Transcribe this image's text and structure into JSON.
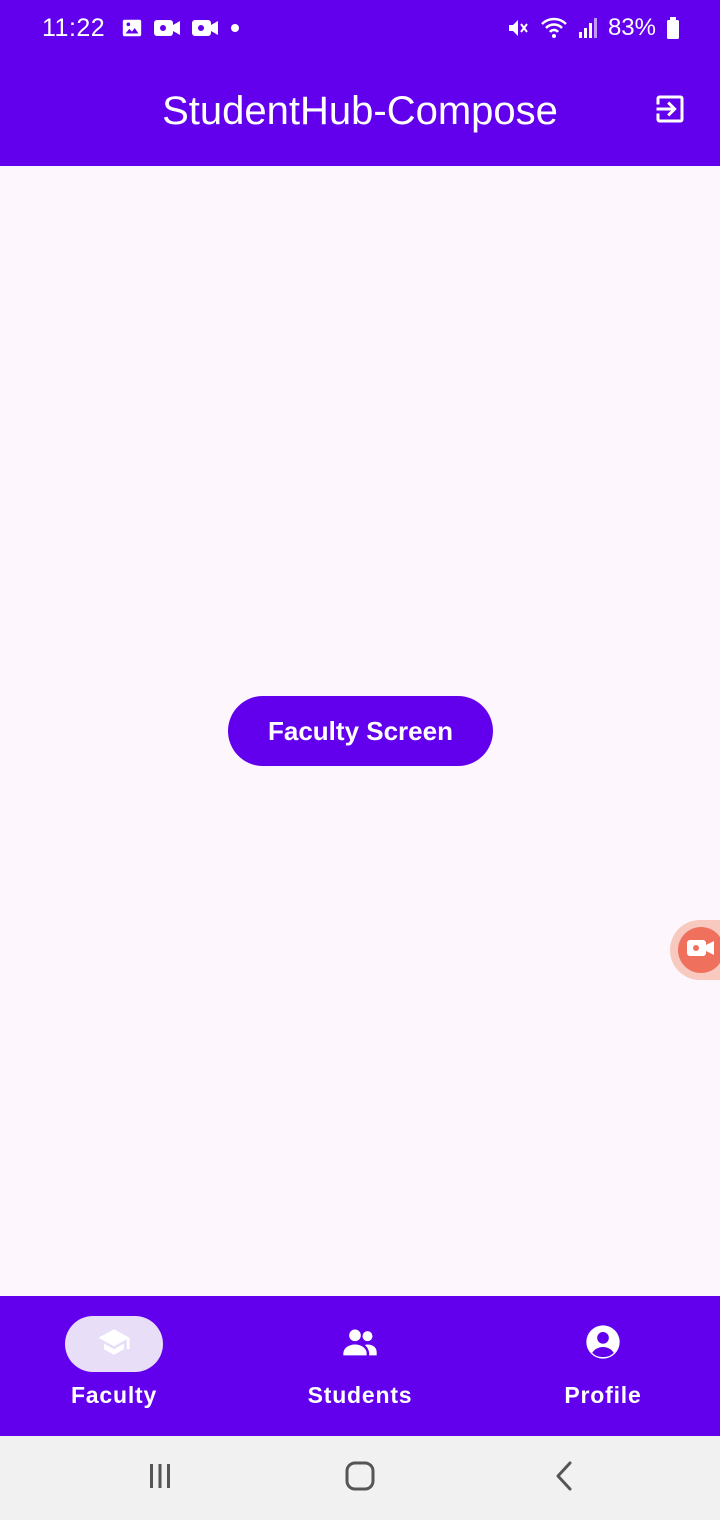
{
  "status_bar": {
    "time": "11:22",
    "battery": "83%",
    "left_icons": [
      "image-icon",
      "video-camera-icon",
      "video-camera-icon",
      "dot-icon"
    ],
    "right_icons": [
      "mute-icon",
      "wifi-icon",
      "signal-icon",
      "battery-icon"
    ]
  },
  "app_bar": {
    "title": "StudentHub-Compose",
    "action_icon": "logout-icon"
  },
  "main": {
    "button_label": "Faculty Screen"
  },
  "floating": {
    "icon": "screen-record-icon"
  },
  "bottom_nav": {
    "items": [
      {
        "label": "Faculty",
        "icon": "graduation-cap-icon",
        "active": true
      },
      {
        "label": "Students",
        "icon": "people-icon",
        "active": false
      },
      {
        "label": "Profile",
        "icon": "account-circle-icon",
        "active": false
      }
    ]
  },
  "system_nav": {
    "buttons": [
      "recents-icon",
      "home-icon",
      "back-icon"
    ]
  },
  "colors": {
    "primary": "#6200EE",
    "background": "#FDF6FD",
    "active_indicator": "#E8DEF8",
    "on_primary": "#FFFFFF"
  }
}
